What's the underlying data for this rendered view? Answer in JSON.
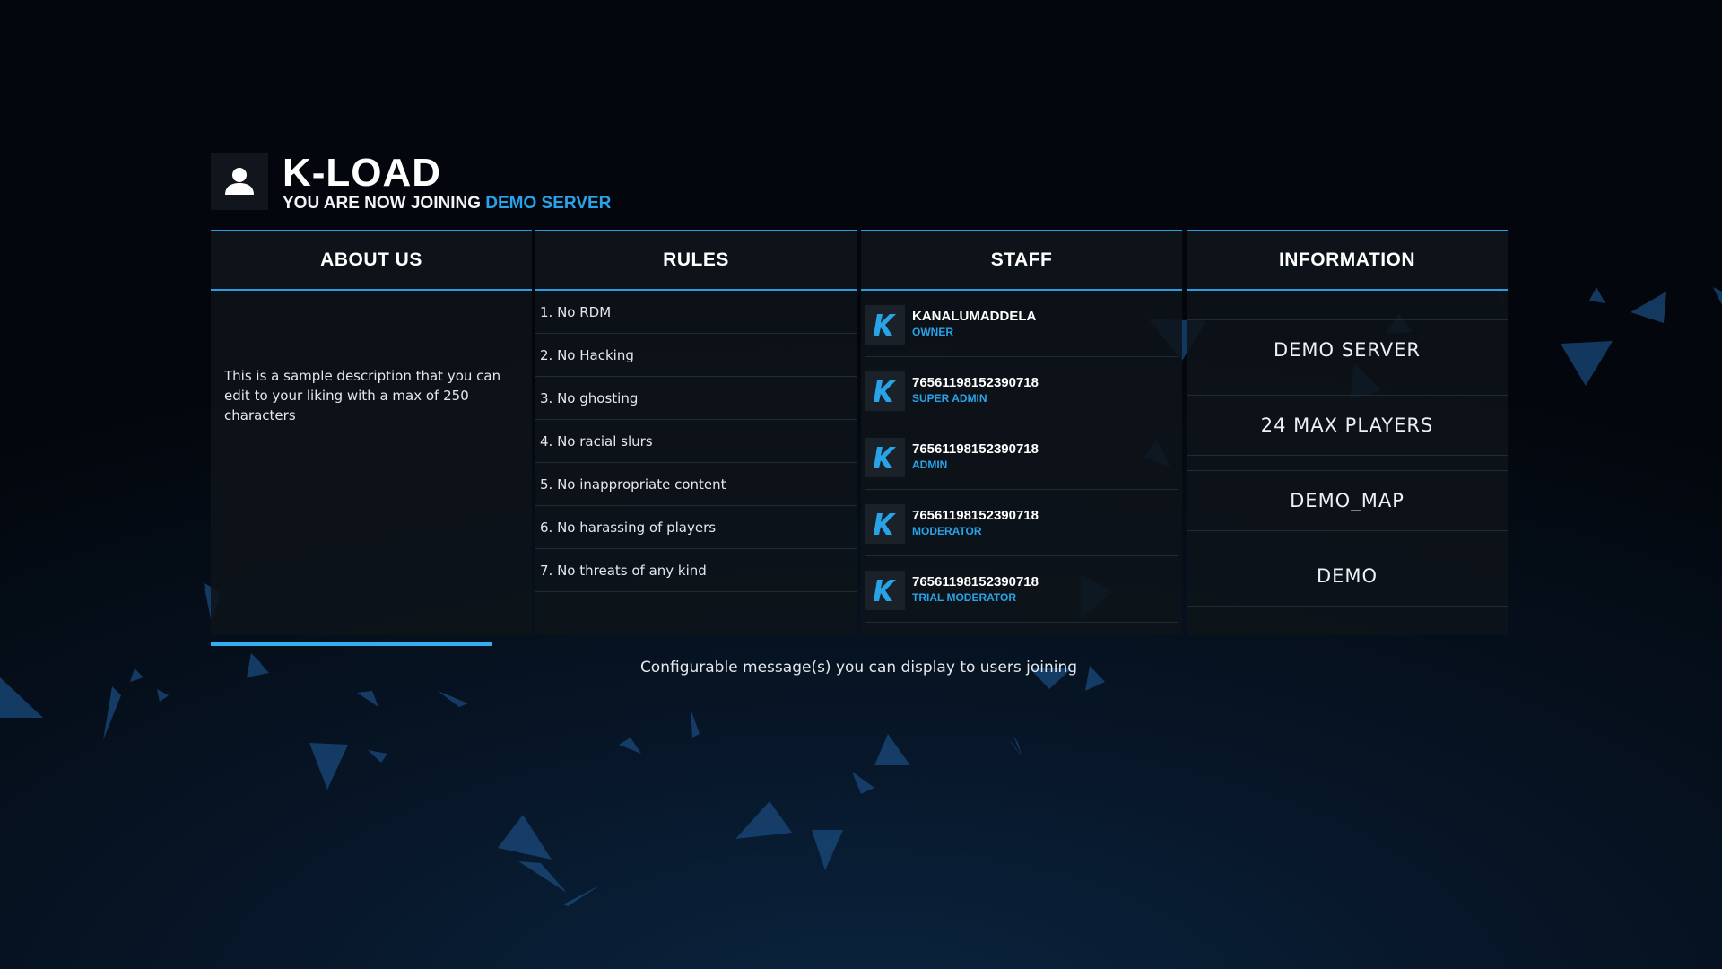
{
  "header": {
    "title": "K-LOAD",
    "subtitle_prefix": "YOU ARE NOW JOINING",
    "server_name": "DEMO SERVER",
    "avatar_icon": "user-icon"
  },
  "panels": {
    "about": {
      "heading": "ABOUT US",
      "text": "This is a sample description that you can edit to your liking with a max of 250 characters"
    },
    "rules": {
      "heading": "RULES",
      "items": [
        "1. No RDM",
        "2. No Hacking",
        "3. No ghosting",
        "4. No racial slurs",
        "5. No inappropriate content",
        "6. No harassing of players",
        "7. No threats of any kind"
      ]
    },
    "staff": {
      "heading": "STAFF",
      "avatar_icon": "k-logo-icon",
      "members": [
        {
          "name": "KANALUMADDELA",
          "rank": "OWNER"
        },
        {
          "name": "76561198152390718",
          "rank": "SUPER ADMIN"
        },
        {
          "name": "76561198152390718",
          "rank": "ADMIN"
        },
        {
          "name": "76561198152390718",
          "rank": "MODERATOR"
        },
        {
          "name": "76561198152390718",
          "rank": "TRIAL MODERATOR"
        }
      ]
    },
    "information": {
      "heading": "INFORMATION",
      "items": [
        "DEMO SERVER",
        "24 MAX PLAYERS",
        "DEMO_MAP",
        "DEMO"
      ]
    }
  },
  "loading": {
    "progress_percent": 21.7
  },
  "footer": {
    "message": "Configurable message(s) you can display to users joining"
  },
  "colors": {
    "accent": "#29a3e8",
    "panel_bg": "#0e1319",
    "background": "#03070d"
  }
}
